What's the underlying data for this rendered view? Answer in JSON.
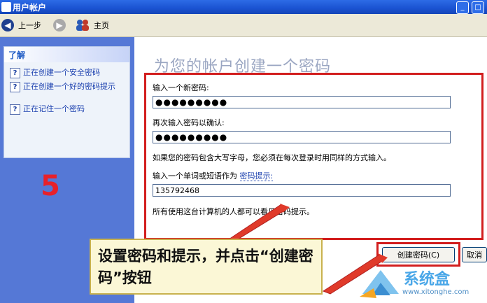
{
  "window": {
    "title": "用户帐户"
  },
  "toolbar": {
    "back_label": "上一步",
    "home_label": "主页"
  },
  "learn": {
    "title": "了解",
    "items": [
      {
        "label": "正在创建一个安全密码"
      },
      {
        "label": "正在创建一个好的密码提示"
      },
      {
        "label": "正在记住一个密码"
      }
    ]
  },
  "annotation": {
    "step_number": "5",
    "callout": "设置密码和提示，并点击“创建密码”按钮"
  },
  "form": {
    "page_title": "为您的帐户创建一个密码",
    "new_password_label": "输入一个新密码:",
    "new_password_value": "●●●●●●●●●",
    "confirm_label": "再次输入密码以确认:",
    "confirm_value": "●●●●●●●●●",
    "case_notice": "如果您的密码包含大写字母，您必须在每次登录时用同样的方式输入。",
    "hint_label_prefix": "输入一个单词或短语作为",
    "hint_link": "密码提示:",
    "hint_value": "135792468",
    "visibility_notice": "所有使用这台计算机的人都可以看见密码提示。"
  },
  "buttons": {
    "create": "创建密码(C)",
    "cancel": "取消"
  },
  "watermark": {
    "name": "系统盒",
    "url": "www.xitonghe.com"
  },
  "colors": {
    "titlebar": "#1a52d1",
    "left_panel": "#5578d6",
    "highlight_red": "#d21e1e",
    "link": "#1a3fae"
  }
}
